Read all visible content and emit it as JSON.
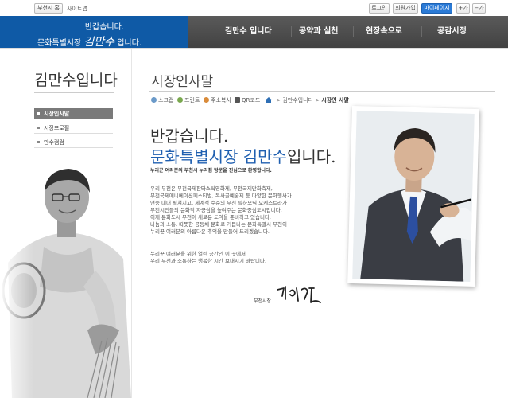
{
  "topbar": {
    "home_btn": "부천시 홈",
    "sitemap_link": "사이트맵",
    "login": "로그인",
    "join": "회원가입",
    "mypage": "마이페이지",
    "font_plus": "+가",
    "font_minus": "−가"
  },
  "brand": {
    "line1": "반갑습니다.",
    "line2_prefix": "문화특별시장",
    "line2_signature": "김만수",
    "line2_suffix": "입니다."
  },
  "gnb": {
    "items": [
      {
        "label": "김만수 입니다"
      },
      {
        "label": "공약과 실천"
      },
      {
        "label": "현장속으로"
      },
      {
        "label": "공감시정"
      }
    ]
  },
  "sidebar": {
    "title": "김만수입니다",
    "items": [
      {
        "label": "시장인사말",
        "active": true
      },
      {
        "label": "시장프로필",
        "active": false
      },
      {
        "label": "만수캠컴",
        "active": false
      }
    ]
  },
  "content": {
    "page_title": "시장인사말",
    "tools": [
      {
        "label": "스크랩",
        "icon": "scrap-icon"
      },
      {
        "label": "프린트",
        "icon": "print-icon"
      },
      {
        "label": "주소복사",
        "icon": "copy-address-icon"
      },
      {
        "label": "QR코드",
        "icon": "qr-code-icon"
      }
    ],
    "breadcrumb": {
      "home_icon": "home-icon",
      "level1": "김만수입니다",
      "separator": ">",
      "current": "시장인 사말"
    },
    "heading_greeting": "반갑습니다.",
    "heading_mayor_highlight": "문화특별시장 김만수",
    "heading_mayor_rest": "입니다.",
    "welcome": "누리꾼 여러분의 부천시 누리집 방문을 진심으로 환영합니다.",
    "paragraph1": [
      "우리 부천은 부천국제판타스틱영화제, 부천국제만화축제,",
      "부천국제애니메이션페스티벌, 복사골예술제 등 다양한 문화행사가",
      "연중 내내 펼쳐지고, 세계적 수준의 부천 필하모닉 오케스트라가",
      "부천시민들의 문화적 자긍심을 높여주는 문화중심도시입니다.",
      "이제 문화도시 부천이 새로운 도약을 준비하고 있습니다.",
      "나눔과 소통, 따뜻한 공동체 문화로 거듭나는 문화특별시 부천이",
      "누리꾼 여러분의 아름다운 추억을 만들어 드리겠습니다."
    ],
    "paragraph2": [
      "누리꾼 여러분을 위한 열린 공간인 이 곳에서",
      "우리 부천과 소통하는 행복한 시간 보내시기 바랍니다."
    ],
    "sign_label": "부천시장"
  },
  "colors": {
    "brand_blue": "#0f5aa6",
    "accent_blue": "#1f5fb0",
    "gnb_dark": "#4a4a4a",
    "mypage_blue": "#2a7ad6"
  }
}
